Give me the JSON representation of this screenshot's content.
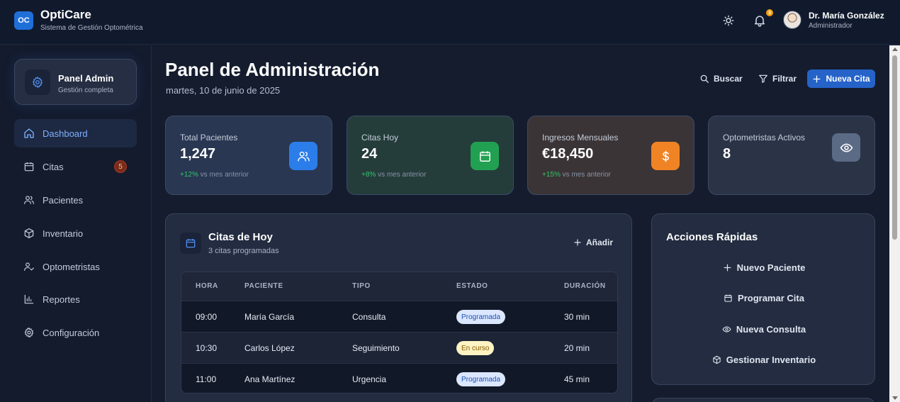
{
  "app": {
    "logo_text": "OC",
    "name": "OptiCare",
    "subtitle": "Sistema de Gestión Optométrica",
    "notification_count": "3",
    "user_name": "Dr. María González",
    "user_role": "Administrador"
  },
  "sidebar": {
    "card_title": "Panel Admin",
    "card_subtitle": "Gestión completa",
    "items": [
      {
        "label": "Dashboard",
        "icon": "home-icon",
        "active": true
      },
      {
        "label": "Citas",
        "icon": "calendar-icon",
        "count": "5"
      },
      {
        "label": "Pacientes",
        "icon": "users-icon"
      },
      {
        "label": "Inventario",
        "icon": "box-icon"
      },
      {
        "label": "Optometristas",
        "icon": "user-check-icon"
      },
      {
        "label": "Reportes",
        "icon": "bar-chart-icon"
      },
      {
        "label": "Configuración",
        "icon": "gear-icon"
      }
    ]
  },
  "header": {
    "title": "Panel de Administración",
    "date": "martes, 10 de junio de 2025",
    "search_label": "Buscar",
    "filter_label": "Filtrar",
    "new_appointment_label": "Nueva Cita"
  },
  "stats": [
    {
      "label": "Total Pacientes",
      "value": "1,247",
      "change": "+12%",
      "note": "vs mes anterior",
      "icon": "users-icon",
      "accent": "#2b7de9"
    },
    {
      "label": "Citas Hoy",
      "value": "24",
      "change": "+8%",
      "note": "vs mes anterior",
      "icon": "calendar-icon",
      "accent": "#22a052"
    },
    {
      "label": "Ingresos Mensuales",
      "value": "€18,450",
      "change": "+15%",
      "note": "vs mes anterior",
      "icon": "dollar-icon",
      "accent": "#f08424"
    },
    {
      "label": "Optometristas Activos",
      "value": "8",
      "icon": "eye-icon",
      "accent": "#5b6b85"
    }
  ],
  "appointments": {
    "title": "Citas de Hoy",
    "subtitle": "3 citas programadas",
    "add_label": "Añadir",
    "columns": [
      "HORA",
      "PACIENTE",
      "TIPO",
      "ESTADO",
      "DURACIÓN"
    ],
    "rows": [
      {
        "time": "09:00",
        "patient": "María García",
        "type": "Consulta",
        "status": "Programada",
        "duration": "30 min"
      },
      {
        "time": "10:30",
        "patient": "Carlos López",
        "type": "Seguimiento",
        "status": "En curso",
        "duration": "20 min"
      },
      {
        "time": "11:00",
        "patient": "Ana Martínez",
        "type": "Urgencia",
        "status": "Programada",
        "duration": "45 min"
      }
    ]
  },
  "quick_actions": {
    "title": "Acciones Rápidas",
    "items": [
      {
        "label": "Nuevo Paciente",
        "icon": "plus-icon"
      },
      {
        "label": "Programar Cita",
        "icon": "calendar-icon"
      },
      {
        "label": "Nueva Consulta",
        "icon": "eye-icon"
      },
      {
        "label": "Gestionar Inventario",
        "icon": "box-icon"
      }
    ]
  }
}
